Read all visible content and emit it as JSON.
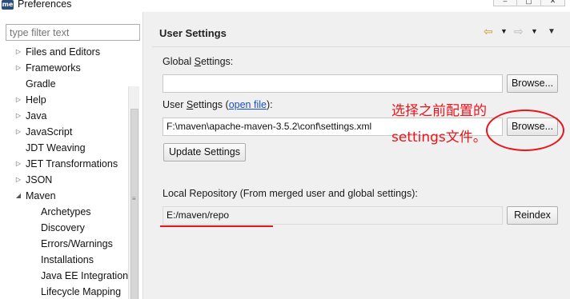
{
  "window": {
    "app_icon_text": "me",
    "title": "Preferences",
    "controls": [
      "–",
      "▢",
      "✕"
    ]
  },
  "sidebar": {
    "filter_placeholder": "type filter text",
    "items": [
      {
        "label": "Files and Editors",
        "arrow": "▷",
        "level": 0
      },
      {
        "label": "Frameworks",
        "arrow": "▷",
        "level": 0
      },
      {
        "label": "Gradle",
        "arrow": "",
        "level": 0
      },
      {
        "label": "Help",
        "arrow": "▷",
        "level": 0
      },
      {
        "label": "Java",
        "arrow": "▷",
        "level": 0
      },
      {
        "label": "JavaScript",
        "arrow": "▷",
        "level": 0
      },
      {
        "label": "JDT Weaving",
        "arrow": "",
        "level": 0
      },
      {
        "label": "JET Transformations",
        "arrow": "▷",
        "level": 0
      },
      {
        "label": "JSON",
        "arrow": "▷",
        "level": 0
      },
      {
        "label": "Maven",
        "arrow": "◢",
        "level": 0
      },
      {
        "label": "Archetypes",
        "arrow": "",
        "level": 1
      },
      {
        "label": "Discovery",
        "arrow": "",
        "level": 1
      },
      {
        "label": "Errors/Warnings",
        "arrow": "",
        "level": 1
      },
      {
        "label": "Installations",
        "arrow": "",
        "level": 1
      },
      {
        "label": "Java EE Integration",
        "arrow": "",
        "level": 1
      },
      {
        "label": "Lifecycle Mapping",
        "arrow": "",
        "level": 1
      }
    ]
  },
  "main": {
    "title": "User Settings",
    "global_settings": {
      "label_pre": "Global ",
      "label_mnemonic": "S",
      "label_post": "ettings:",
      "value": "",
      "browse_label": "Browse..."
    },
    "user_settings": {
      "label_pre": "User ",
      "label_mnemonic": "S",
      "label_post": "ettings (",
      "link": "open file",
      "label_end": "):",
      "value": "F:\\maven\\apache-maven-3.5.2\\conf\\settings.xml",
      "browse_label": "Browse...",
      "update_label": "Update Settings"
    },
    "local_repository": {
      "label": "Local Repository (From merged user and global settings):",
      "value": "E:/maven/repo",
      "reindex_label": "Reindex"
    }
  },
  "annotation": {
    "line1": "选择之前配置的",
    "line2": "settings文件。",
    "color": "#e8151b"
  }
}
